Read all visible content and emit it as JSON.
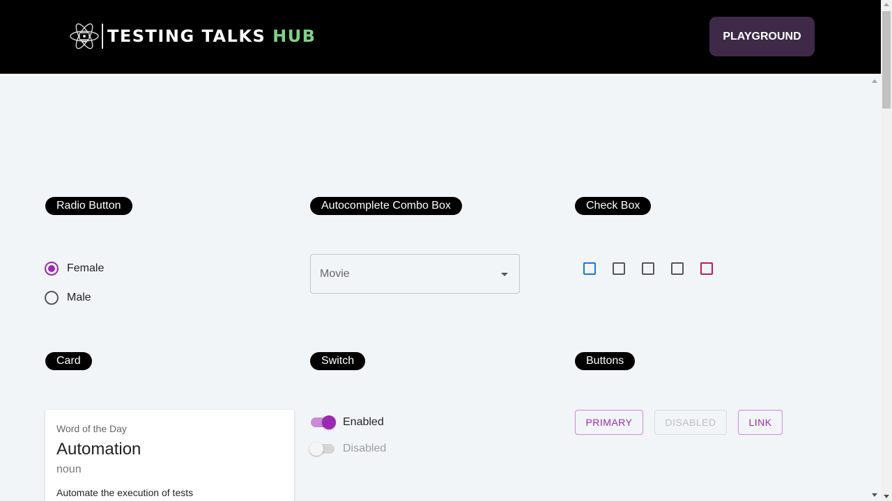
{
  "header": {
    "logo_main": "TESTING TALKS ",
    "logo_accent": "HUB",
    "playground_label": "PLAYGROUND"
  },
  "sections": {
    "radio": "Radio Button",
    "combo": "Autocomplete Combo Box",
    "checkbox": "Check Box",
    "card": "Card",
    "switch": "Switch",
    "buttons": "Buttons"
  },
  "radio": {
    "options": [
      {
        "label": "Female",
        "checked": true
      },
      {
        "label": "Male",
        "checked": false
      }
    ]
  },
  "combo": {
    "placeholder": "Movie",
    "value": ""
  },
  "checkboxes": [
    {
      "color": "#1976d2",
      "checked": false
    },
    {
      "color": "#555555",
      "checked": false
    },
    {
      "color": "#555555",
      "checked": false
    },
    {
      "color": "#555555",
      "checked": false
    },
    {
      "color": "#c2185b",
      "checked": false
    }
  ],
  "card": {
    "overline": "Word of the Day",
    "title": "Automation",
    "pos": "noun",
    "body": "Automate the execution of tests"
  },
  "switches": [
    {
      "label": "Enabled",
      "on": true,
      "disabled": false
    },
    {
      "label": "Disabled",
      "on": false,
      "disabled": true
    }
  ],
  "buttons": [
    {
      "label": "PRIMARY",
      "disabled": false
    },
    {
      "label": "DISABLED",
      "disabled": true
    },
    {
      "label": "LINK",
      "disabled": false
    }
  ],
  "colors": {
    "accent": "#9c27b0",
    "header_bg": "#000000",
    "playground_bg": "#3e2a48",
    "page_bg": "#f2f5f8",
    "logo_hub": "#7fd18a"
  }
}
